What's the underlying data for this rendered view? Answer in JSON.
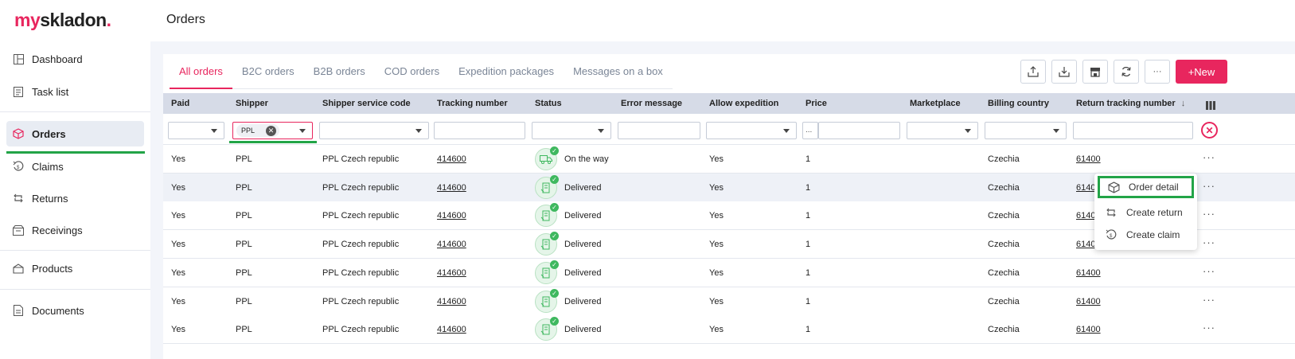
{
  "brand": {
    "my": "my",
    "name": "skladon",
    "dot": "."
  },
  "header": {
    "title": "Orders"
  },
  "sidebar": {
    "items": [
      {
        "label": "Dashboard",
        "icon": "dashboard-icon"
      },
      {
        "label": "Task list",
        "icon": "clipboard-icon"
      },
      {
        "label": "Orders",
        "icon": "box-icon",
        "active": true
      },
      {
        "label": "Claims",
        "icon": "claim-icon"
      },
      {
        "label": "Returns",
        "icon": "return-icon"
      },
      {
        "label": "Receivings",
        "icon": "receiving-icon"
      },
      {
        "label": "Products",
        "icon": "products-icon"
      },
      {
        "label": "Documents",
        "icon": "document-icon"
      }
    ]
  },
  "tabs": [
    "All orders",
    "B2C orders",
    "B2B orders",
    "COD orders",
    "Expedition packages",
    "Messages on a box"
  ],
  "toolbar": {
    "new_label": "+New",
    "more_label": "···"
  },
  "columns": [
    "Paid",
    "Shipper",
    "Shipper service code",
    "Tracking number",
    "Status",
    "Error message",
    "Allow expedition",
    "Price",
    "Marketplace",
    "Billing country",
    "Return tracking number"
  ],
  "filters": {
    "shipper_chip": "PPL",
    "price_prefix": "..."
  },
  "rows": [
    {
      "paid": "Yes",
      "shipper": "PPL",
      "service": "PPL Czech republic",
      "tracking": "414600",
      "status": "On the way",
      "allow": "Yes",
      "price": "1",
      "country": "Czechia",
      "return_tracking": "61400"
    },
    {
      "paid": "Yes",
      "shipper": "PPL",
      "service": "PPL Czech republic",
      "tracking": "414600",
      "status": "Delivered",
      "allow": "Yes",
      "price": "1",
      "country": "Czechia",
      "return_tracking": "6140"
    },
    {
      "paid": "Yes",
      "shipper": "PPL",
      "service": "PPL Czech republic",
      "tracking": "414600",
      "status": "Delivered",
      "allow": "Yes",
      "price": "1",
      "country": "Czechia",
      "return_tracking": "6140"
    },
    {
      "paid": "Yes",
      "shipper": "PPL",
      "service": "PPL Czech republic",
      "tracking": "414600",
      "status": "Delivered",
      "allow": "Yes",
      "price": "1",
      "country": "Czechia",
      "return_tracking": "6140"
    },
    {
      "paid": "Yes",
      "shipper": "PPL",
      "service": "PPL Czech republic",
      "tracking": "414600",
      "status": "Delivered",
      "allow": "Yes",
      "price": "1",
      "country": "Czechia",
      "return_tracking": "61400"
    },
    {
      "paid": "Yes",
      "shipper": "PPL",
      "service": "PPL Czech republic",
      "tracking": "414600",
      "status": "Delivered",
      "allow": "Yes",
      "price": "1",
      "country": "Czechia",
      "return_tracking": "61400"
    },
    {
      "paid": "Yes",
      "shipper": "PPL",
      "service": "PPL Czech republic",
      "tracking": "414600",
      "status": "Delivered",
      "allow": "Yes",
      "price": "1",
      "country": "Czechia",
      "return_tracking": "61400"
    }
  ],
  "context_menu": {
    "items": [
      {
        "label": "Order detail",
        "icon": "package-icon"
      },
      {
        "label": "Create return",
        "icon": "return-icon"
      },
      {
        "label": "Create claim",
        "icon": "claim-icon"
      }
    ]
  },
  "colors": {
    "accent": "#e8265e",
    "highlight": "#22a447",
    "header_bg": "#d6dbe7"
  }
}
